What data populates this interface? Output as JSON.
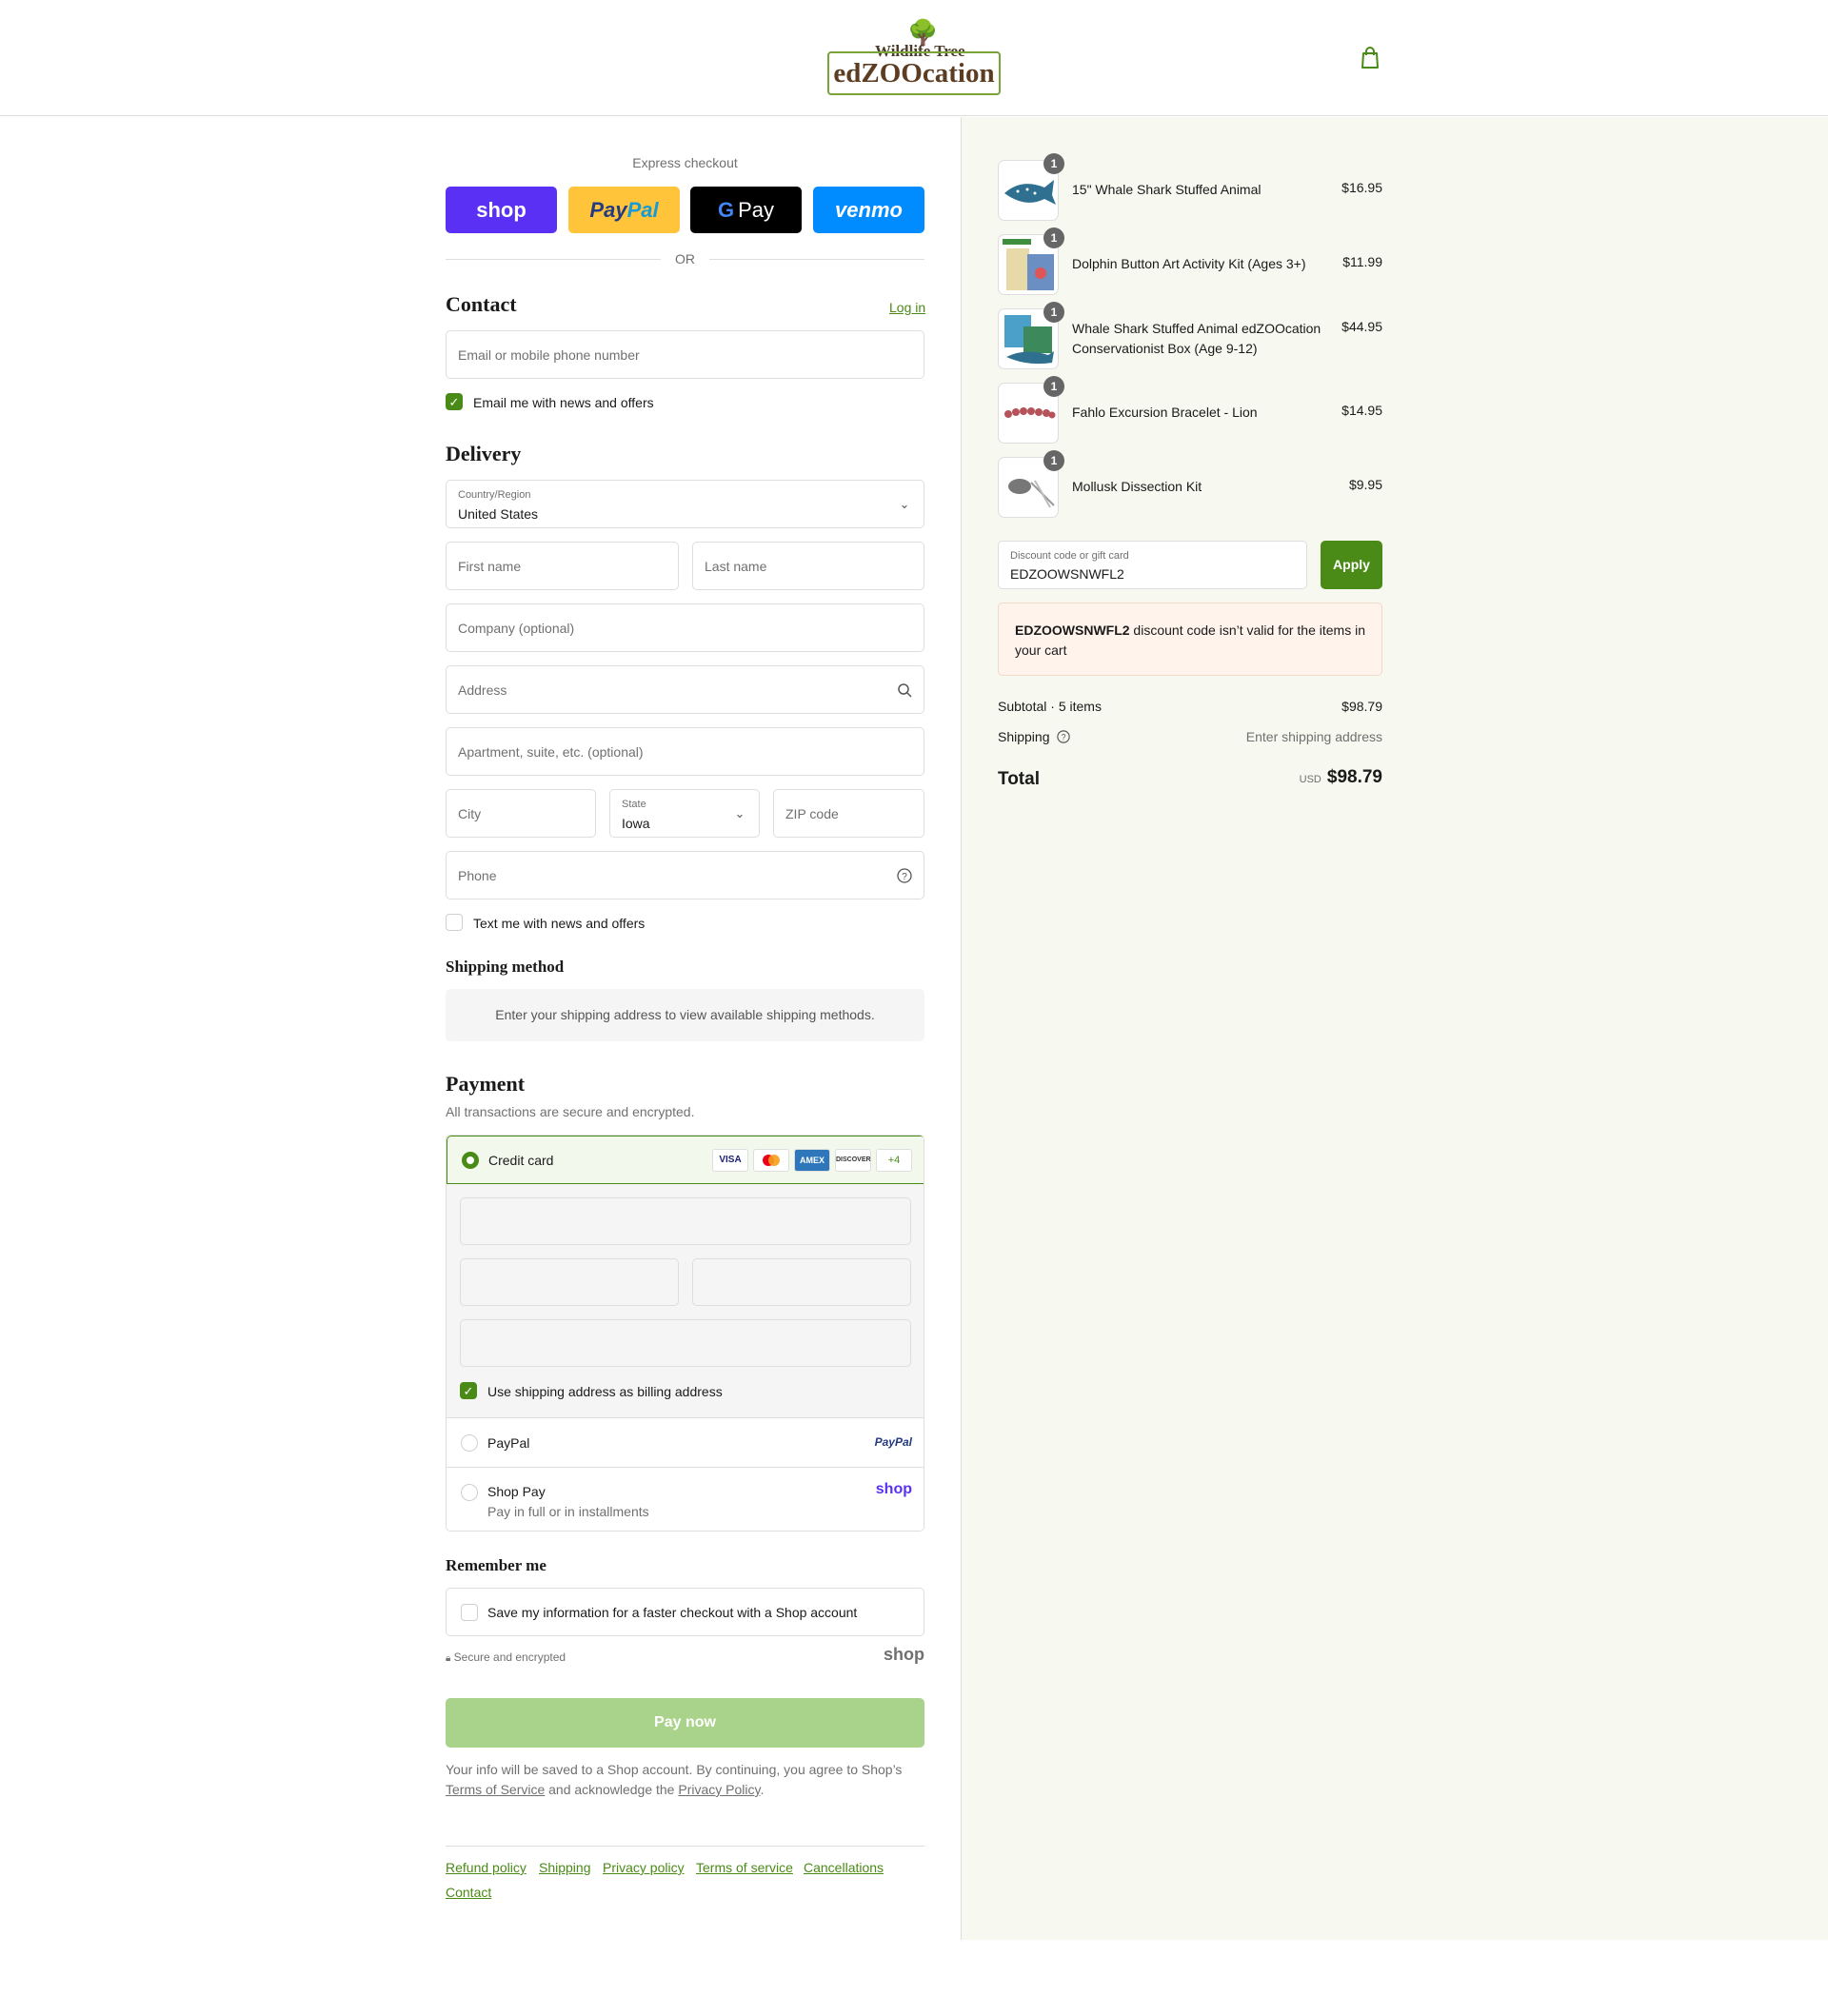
{
  "header": {
    "logo_tagline": "Wildlife Tree",
    "logo_name": "edZOOcation",
    "cart_icon": "shopping-bag-icon"
  },
  "express": {
    "label": "Express checkout",
    "shop": "shop",
    "paypal_a": "Pay",
    "paypal_b": "Pal",
    "gpay_g": "G",
    "gpay_text": "Pay",
    "venmo": "venmo",
    "or": "OR"
  },
  "contact": {
    "title": "Contact",
    "login": "Log in",
    "email_placeholder": "Email or mobile phone number",
    "news_label": "Email me with news and offers",
    "news_checked": true
  },
  "delivery": {
    "title": "Delivery",
    "country_label": "Country/Region",
    "country_value": "United States",
    "first_name": "First name",
    "last_name": "Last name",
    "company": "Company (optional)",
    "address": "Address",
    "apartment": "Apartment, suite, etc. (optional)",
    "city": "City",
    "state_label": "State",
    "state_value": "Iowa",
    "zip": "ZIP code",
    "phone": "Phone",
    "text_label": "Text me with news and offers"
  },
  "shipping_method": {
    "title": "Shipping method",
    "info": "Enter your shipping address to view available shipping methods."
  },
  "payment": {
    "title": "Payment",
    "subtitle": "All transactions are secure and encrypted.",
    "credit_card": "Credit card",
    "cards": [
      "VISA",
      "MC",
      "AMEX",
      "DISCOVER"
    ],
    "more_cards": "+4",
    "billing_label": "Use shipping address as billing address",
    "paypal": "PayPal",
    "paypal_logo": "PayPal",
    "shop_pay": "Shop Pay",
    "shop_pay_sub": "Pay in full or in installments",
    "shop_logo": "shop"
  },
  "remember": {
    "title": "Remember me",
    "save_label": "Save my information for a faster checkout with a Shop account",
    "secure": "Secure and encrypted",
    "shop_logo": "shop"
  },
  "pay_now": "Pay now",
  "legal": {
    "text1": "Your info will be saved to a Shop account. By continuing, you agree to Shop’s",
    "tos": "Terms of Service",
    "text2": "and acknowledge the",
    "privacy": "Privacy Policy",
    "end": "."
  },
  "footer": {
    "links": [
      "Refund policy",
      "Shipping",
      "Privacy policy",
      "Terms of service",
      "Cancellations",
      "Contact"
    ]
  },
  "cart": {
    "items": [
      {
        "name": "15\" Whale Shark Stuffed Animal",
        "price": "$16.95",
        "qty": "1"
      },
      {
        "name": "Dolphin Button Art Activity Kit (Ages 3+)",
        "price": "$11.99",
        "qty": "1"
      },
      {
        "name": "Whale Shark Stuffed Animal edZOOcation Conservationist Box (Age 9-12)",
        "price": "$44.95",
        "qty": "1"
      },
      {
        "name": "Fahlo Excursion Bracelet - Lion",
        "price": "$14.95",
        "qty": "1"
      },
      {
        "name": "Mollusk Dissection Kit",
        "price": "$9.95",
        "qty": "1"
      }
    ],
    "discount_label": "Discount code or gift card",
    "discount_value": "EDZOOWSNWFL2",
    "apply": "Apply",
    "error_code": "EDZOOWSNWFL2",
    "error_text": " discount code isn’t valid for the items in your cart",
    "subtotal_label": "Subtotal · 5 items",
    "subtotal": "$98.79",
    "shipping_label": "Shipping",
    "shipping_value": "Enter shipping address",
    "total_label": "Total",
    "currency": "USD",
    "total": "$98.79"
  },
  "colors": {
    "accent": "#4a8a16",
    "pay_now_disabled": "#a9d38a",
    "aside_bg": "#f7f8ef"
  }
}
